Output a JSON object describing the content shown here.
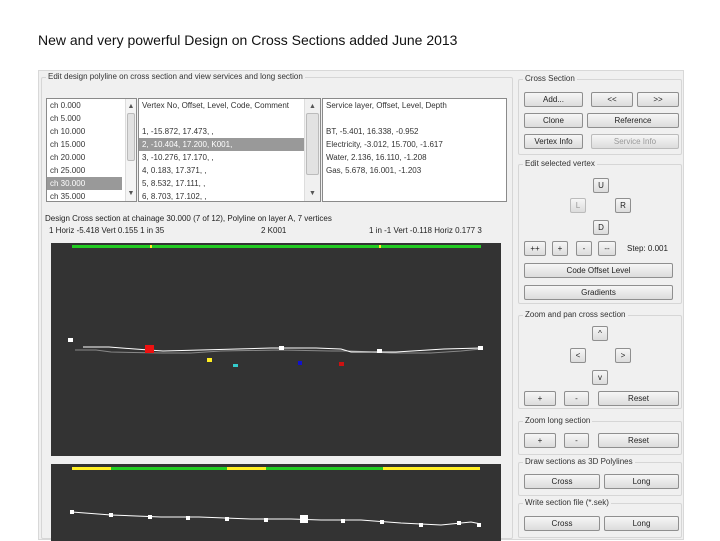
{
  "title": "New and very powerful Design on Cross Sections added June 2013",
  "left": {
    "group_label": "Edit design polyline on cross section and view services and long section",
    "chainages": [
      "ch 0.000",
      "ch 5.000",
      "ch 10.000",
      "ch 15.000",
      "ch 20.000",
      "ch 25.000",
      "ch 30.000",
      "ch 35.000"
    ],
    "selected_chainage": "ch 30.000",
    "vertices": [
      "Vertex No, Offset, Level, Code, Comment",
      "",
      "1, -15.872, 17.473, ,",
      "2, -10.404, 17.200, K001,",
      "3, -10.276, 17.170, ,",
      "4, 0.183, 17.371, ,",
      "5, 8.532, 17.111, ,",
      "6, 8.703, 17.102, ,"
    ],
    "services": [
      "Service layer, Offset, Level, Depth",
      "",
      "BT, -5.401, 16.338, -0.952",
      "Electricity, -3.012, 15.700, -1.617",
      "Water, 2.136, 16.110, -1.208",
      "Gas, 5.678, 16.001, -1.203"
    ],
    "status": "Design Cross section at chainage 30.000 (7 of 12), Polyline on layer A, 7 vertices",
    "seg_left": "1   Horiz -5.418   Vert 0.155   1 in 35",
    "seg_code": "2 K001",
    "seg_right": "1 in -1   Vert -0.118   Horiz 0.177   3"
  },
  "right": {
    "cross_section": {
      "label": "Cross Section",
      "add": "Add...",
      "prev": "<<",
      "next": ">>",
      "clone": "Clone",
      "reference": "Reference",
      "vertex_info": "Vertex Info",
      "service_info": "Service Info"
    },
    "edit_vertex": {
      "label": "Edit selected vertex",
      "up": "U",
      "left": "L",
      "right": "R",
      "down": "D",
      "pp": "++",
      "p": "+",
      "m": "-",
      "mm": "--",
      "step": "Step: 0.001",
      "code_offset_level": "Code Offset Level",
      "gradients": "Gradients"
    },
    "zoom_pan": {
      "label": "Zoom and pan cross section",
      "up": "^",
      "left": "<",
      "right": ">",
      "down": "v",
      "plus": "+",
      "minus": "-",
      "reset": "Reset"
    },
    "zoom_long": {
      "label": "Zoom long section",
      "plus": "+",
      "minus": "-",
      "reset": "Reset"
    },
    "draw_3d": {
      "label": "Draw sections as 3D Polylines",
      "cross": "Cross",
      "long": "Long"
    },
    "write_file": {
      "label": "Write section file (*.sek)",
      "cross": "Cross",
      "long": "Long"
    }
  },
  "colors": {
    "canvas": "#333333",
    "green": "#22cc22",
    "yellow": "#ffee22",
    "red": "#ee1111",
    "blue": "#1111cc",
    "cyan": "#33cccc"
  }
}
